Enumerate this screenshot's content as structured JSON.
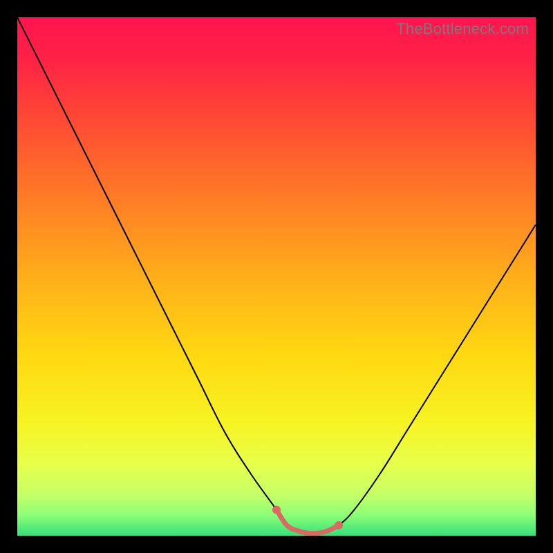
{
  "watermark": "TheBottleneck.com",
  "colors": {
    "background": "#000000",
    "gradient_stops": [
      {
        "offset": 0.0,
        "color": "#ff1450"
      },
      {
        "offset": 0.08,
        "color": "#ff2246"
      },
      {
        "offset": 0.2,
        "color": "#ff4a34"
      },
      {
        "offset": 0.35,
        "color": "#ff7c26"
      },
      {
        "offset": 0.5,
        "color": "#ffae1a"
      },
      {
        "offset": 0.65,
        "color": "#ffd812"
      },
      {
        "offset": 0.78,
        "color": "#f7f322"
      },
      {
        "offset": 0.86,
        "color": "#e8ff4a"
      },
      {
        "offset": 0.92,
        "color": "#c6ff66"
      },
      {
        "offset": 0.96,
        "color": "#8dff77"
      },
      {
        "offset": 1.0,
        "color": "#33e07a"
      }
    ],
    "curve": "#000000",
    "accent": "#d86a63"
  },
  "chart_data": {
    "type": "line",
    "title": "",
    "xlabel": "",
    "ylabel": "",
    "xlim": [
      0,
      100
    ],
    "ylim": [
      0,
      100
    ],
    "grid": false,
    "series": [
      {
        "name": "bottleneck-curve",
        "x": [
          0,
          5,
          10,
          15,
          20,
          25,
          30,
          35,
          40,
          45,
          50,
          52,
          54,
          56,
          58,
          60,
          62,
          65,
          70,
          75,
          80,
          85,
          90,
          95,
          100
        ],
        "y": [
          100,
          90,
          80,
          70,
          60,
          50,
          40,
          30,
          20,
          12,
          5,
          2,
          1,
          0.5,
          0.5,
          1,
          2,
          5,
          12,
          20,
          28,
          36,
          44,
          52,
          60
        ]
      }
    ],
    "accent_segment": {
      "name": "optimal-range",
      "x": [
        50,
        52,
        54,
        56,
        58,
        60,
        62
      ],
      "y": [
        5,
        2,
        1,
        0.5,
        0.5,
        1,
        2
      ]
    },
    "annotations": []
  }
}
